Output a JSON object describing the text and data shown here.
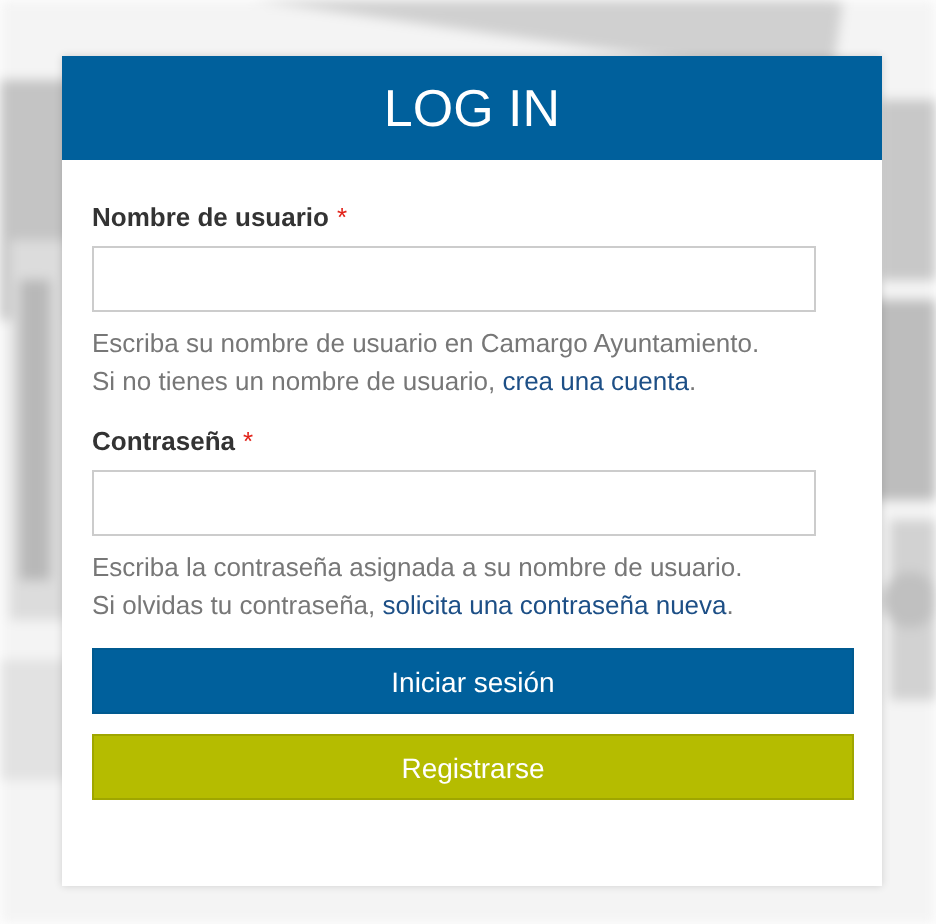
{
  "title": "LOG IN",
  "fields": [
    {
      "label": "Nombre de usuario",
      "required_mark": "*",
      "help_first": "Escriba su nombre de usuario en Camargo Ayuntamiento.",
      "help_second": "Si no tienes un nombre de usuario,",
      "link": "crea una cuenta",
      "after": "."
    },
    {
      "label": "Contraseña",
      "required_mark": "*",
      "help_first": "Escriba la contraseña asignada a su nombre de usuario.",
      "help_second": "Si olvidas tu contraseña,",
      "link": "solicita una contraseña nueva",
      "after": "."
    }
  ],
  "buttons": [
    {
      "label": "Iniciar sesión",
      "kind": "primary"
    },
    {
      "label": "Registrarse",
      "kind": "secondary"
    }
  ]
}
